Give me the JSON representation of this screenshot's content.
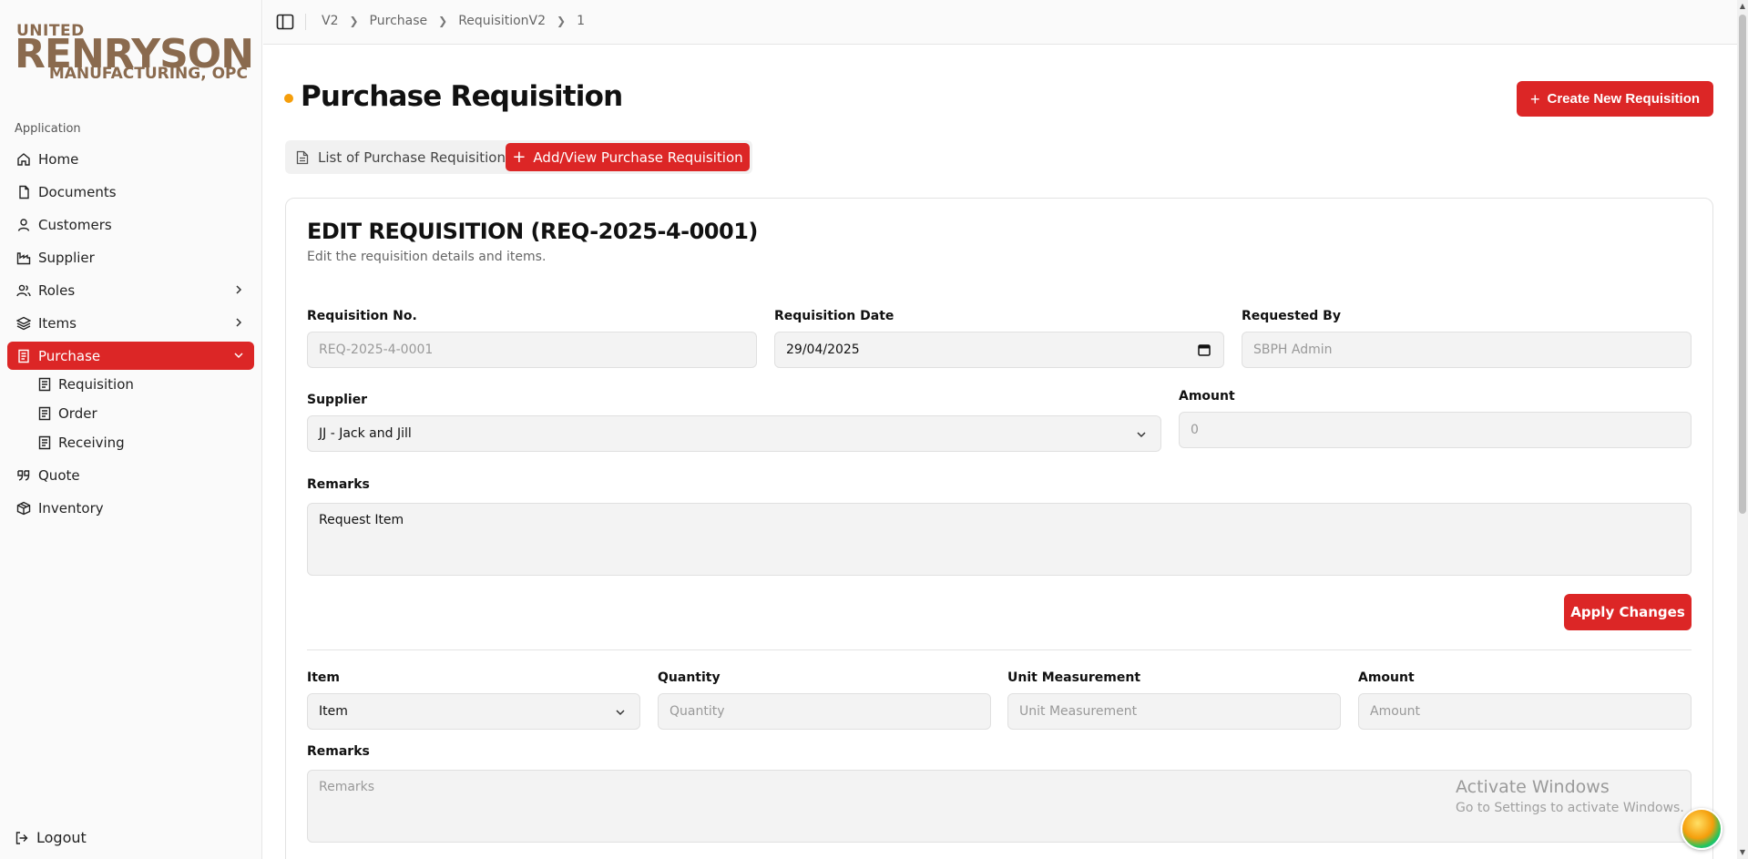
{
  "brand": {
    "line1": "UNITED",
    "line2": "RENRYSON",
    "line3": "MANUFACTURING, OPC"
  },
  "sidebar": {
    "section": "Application",
    "items": [
      {
        "label": "Home",
        "icon": "home-icon"
      },
      {
        "label": "Documents",
        "icon": "file-icon"
      },
      {
        "label": "Customers",
        "icon": "user-icon"
      },
      {
        "label": "Supplier",
        "icon": "factory-icon"
      },
      {
        "label": "Roles",
        "icon": "users-icon"
      },
      {
        "label": "Items",
        "icon": "layers-icon"
      },
      {
        "label": "Purchase",
        "icon": "receipt-icon"
      },
      {
        "label": "Quote",
        "icon": "quote-icon"
      },
      {
        "label": "Inventory",
        "icon": "box-icon"
      }
    ],
    "purchase_sub": [
      "Requisition",
      "Order",
      "Receiving"
    ],
    "logout": "Logout",
    "accent": "#dc2626"
  },
  "breadcrumb": [
    "V2",
    "Purchase",
    "RequisitionV2",
    "1"
  ],
  "header": {
    "title": "Purchase Requisition",
    "create_button": "Create New Requisition"
  },
  "tabs": {
    "list": "List of Purchase Requisition",
    "add_view": "Add/View Purchase Requisition"
  },
  "form": {
    "title": "EDIT REQUISITION (REQ-2025-4-0001)",
    "subtitle": "Edit the requisition details and items.",
    "req_no_label": "Requisition No.",
    "req_no_value": "REQ-2025-4-0001",
    "req_date_label": "Requisition Date",
    "req_date_value": "29/04/2025",
    "requested_by_label": "Requested By",
    "requested_by_value": "SBPH Admin",
    "supplier_label": "Supplier",
    "supplier_value": "JJ - Jack and Jill",
    "amount_label": "Amount",
    "amount_value": "0",
    "remarks_label": "Remarks",
    "remarks_value": "Request Item",
    "apply_button": "Apply Changes"
  },
  "item_form": {
    "item_label": "Item",
    "item_value": "Item",
    "quantity_label": "Quantity",
    "quantity_placeholder": "Quantity",
    "unit_label": "Unit Measurement",
    "unit_placeholder": "Unit Measurement",
    "amount_label": "Amount",
    "amount_placeholder": "Amount",
    "remarks_label": "Remarks",
    "remarks_placeholder": "Remarks"
  },
  "watermark": {
    "line1": "Activate Windows",
    "line2": "Go to Settings to activate Windows."
  }
}
